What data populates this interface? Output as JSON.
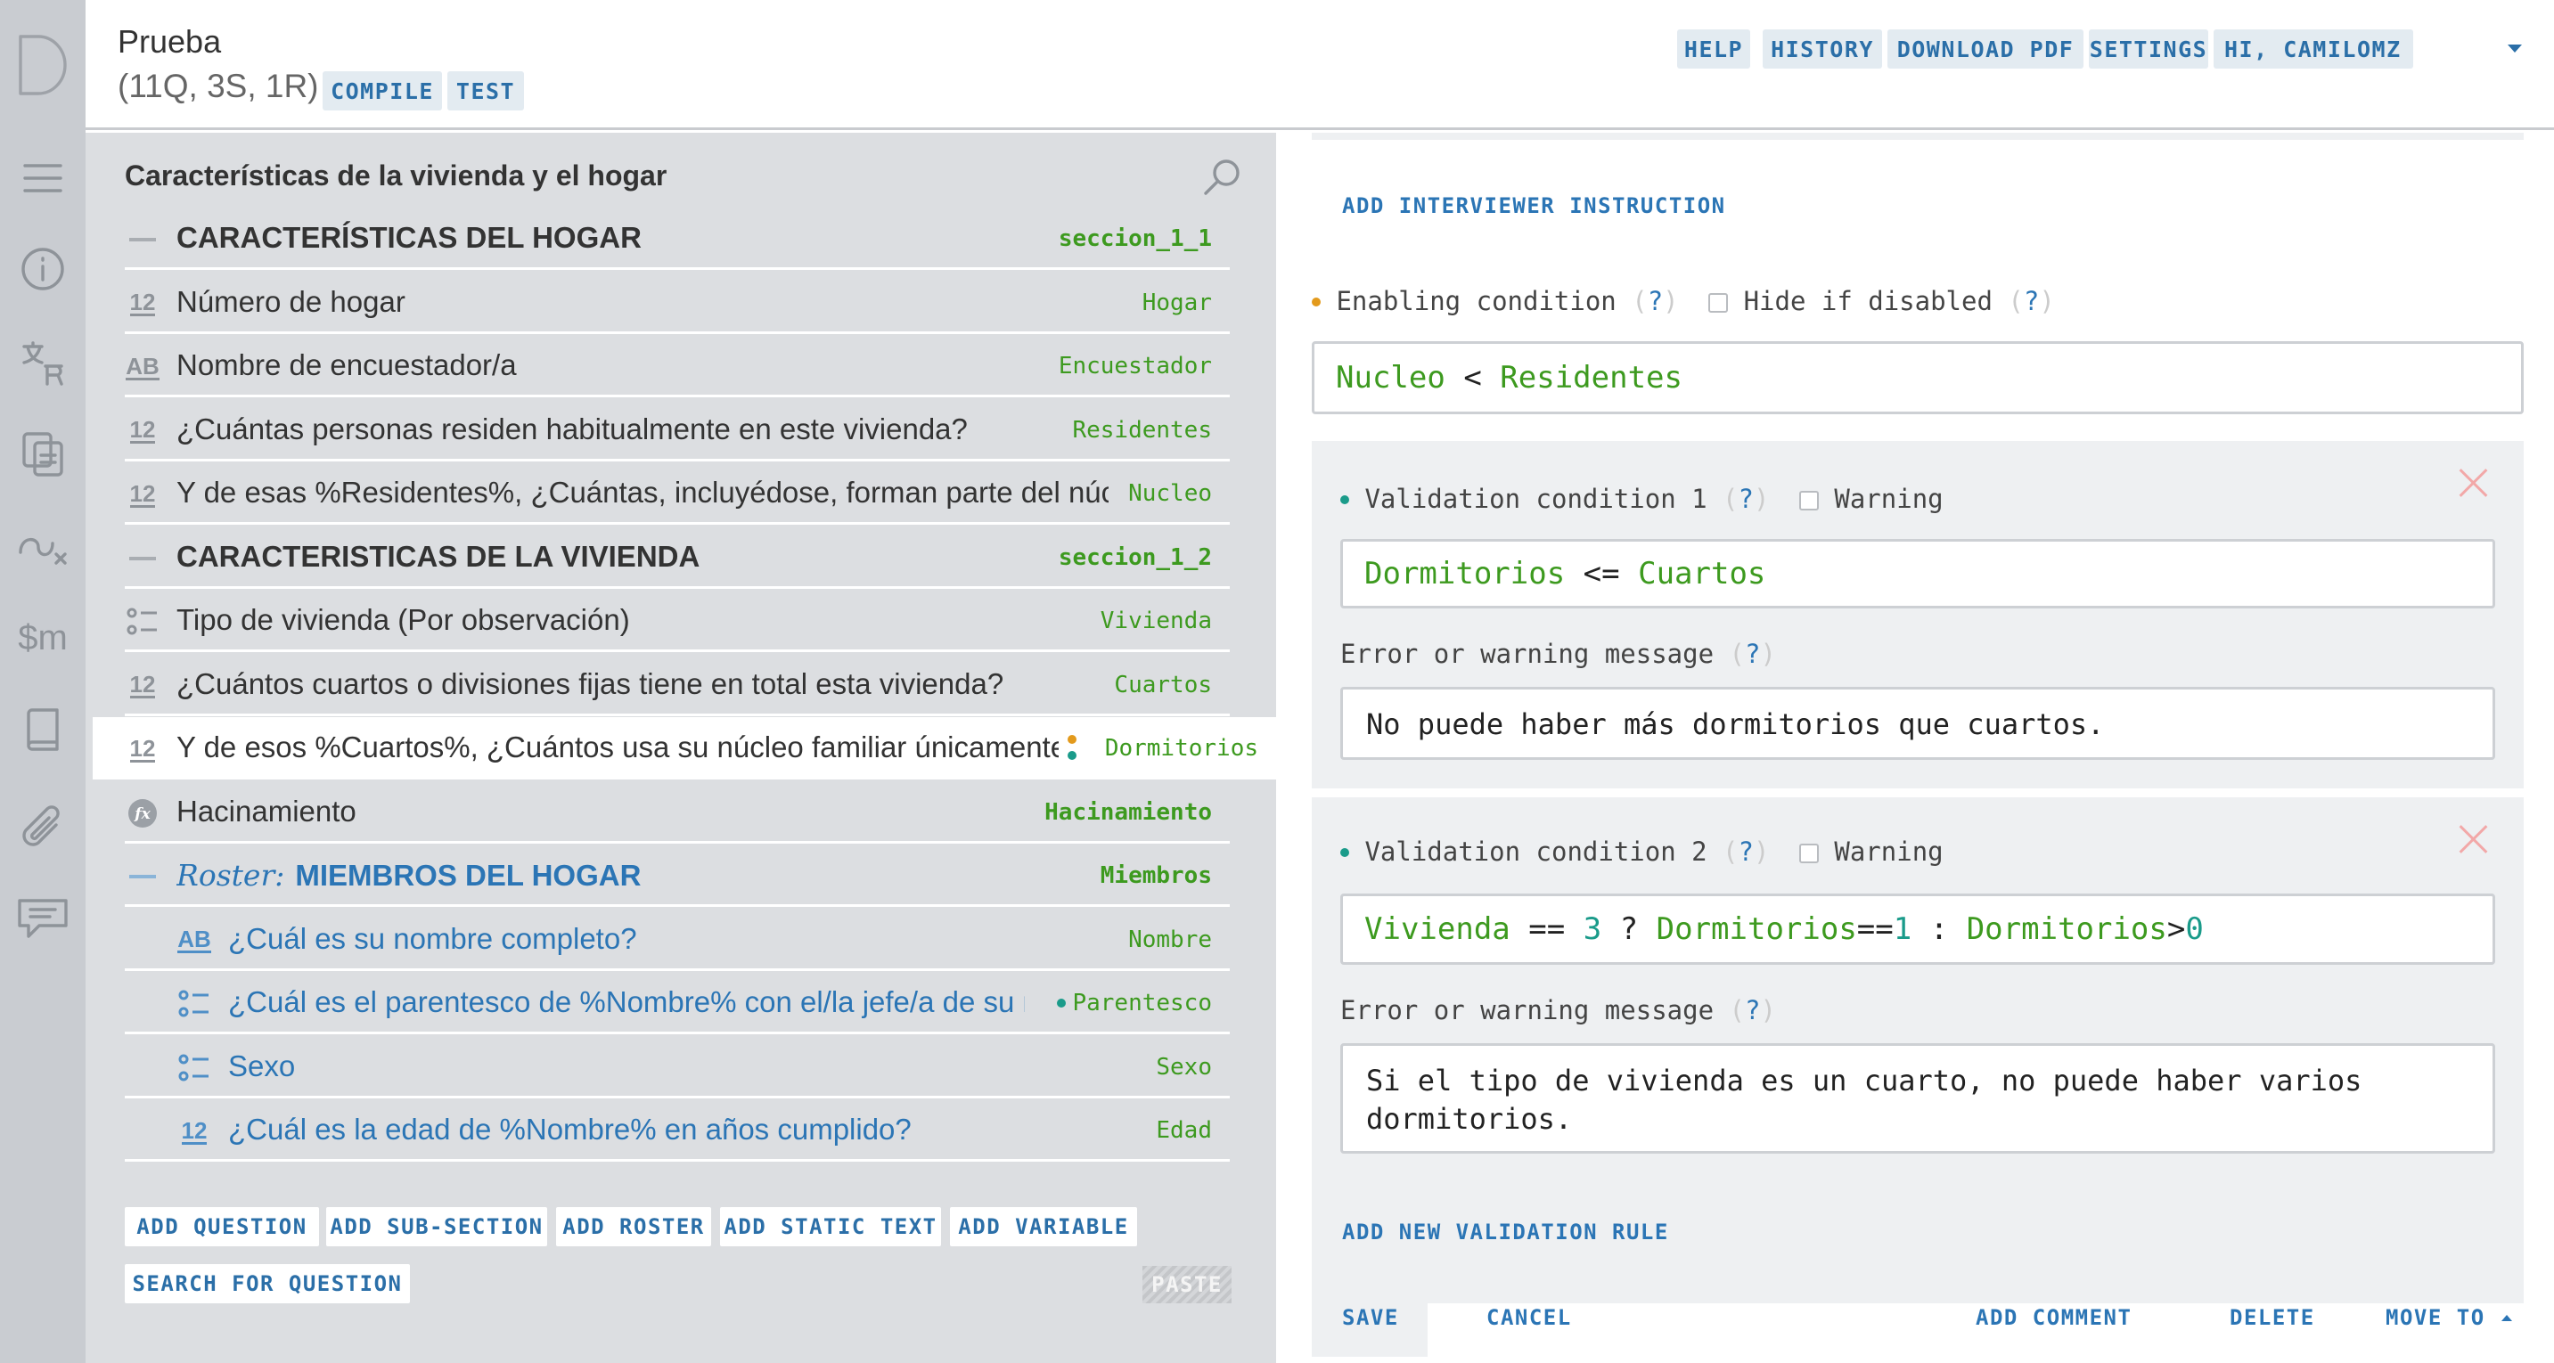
{
  "header": {
    "title": "Prueba",
    "counts": "(11Q, 3S, 1R)",
    "compile": "COMPILE",
    "test": "TEST",
    "help": "HELP",
    "history": "HISTORY",
    "download_pdf": "DOWNLOAD PDF",
    "settings": "SETTINGS",
    "user": "HI, CAMILOMZ"
  },
  "rail": {
    "logo": "D",
    "icons": [
      "menu-icon",
      "info-icon",
      "translate-icon",
      "copy-icon",
      "route-icon",
      "macros-icon",
      "book-icon",
      "attachment-icon",
      "comments-icon"
    ],
    "macro_label": "$m"
  },
  "outline": {
    "section_title": "Características de la vivienda y el hogar",
    "rows": [
      {
        "type": "section",
        "icon": "—",
        "text": "CARACTERÍSTICAS DEL HOGAR",
        "var": "seccion_1_1"
      },
      {
        "type": "numeric",
        "icon": "12",
        "text": "Número de hogar",
        "var": "Hogar"
      },
      {
        "type": "text",
        "icon": "AB",
        "text": "Nombre de encuestador/a",
        "var": "Encuestador"
      },
      {
        "type": "numeric",
        "icon": "12",
        "text": "¿Cuántas personas residen habitualmente en este vivienda?",
        "var": "Residentes"
      },
      {
        "type": "numeric",
        "icon": "12",
        "text": "Y de esas %Residentes%, ¿Cuántas, incluyédose, forman parte del núcleo",
        "var": "Nucleo"
      },
      {
        "type": "section",
        "icon": "—",
        "text": "CARACTERISTICAS DE LA VIVIENDA",
        "var": "seccion_1_2"
      },
      {
        "type": "single",
        "icon": "list",
        "text": "Tipo de vivienda (Por observación)",
        "var": "Vivienda"
      },
      {
        "type": "numeric",
        "icon": "12",
        "text": "¿Cuántos cuartos o divisiones fijas tiene en total esta vivienda?",
        "var": "Cuartos"
      },
      {
        "type": "numeric",
        "icon": "12",
        "text": "Y de esos %Cuartos%, ¿Cuántos usa su núcleo familiar únicamente",
        "var": "Dormitorios"
      },
      {
        "type": "variable",
        "icon": "fx",
        "text": "Hacinamiento",
        "var": "Hacinamiento"
      },
      {
        "type": "roster",
        "icon": "—",
        "roster_label": "Roster:",
        "text": "MIEMBROS DEL HOGAR",
        "var": "Miembros"
      },
      {
        "type": "text",
        "icon": "AB",
        "text": "¿Cuál es su nombre completo?",
        "var": "Nombre"
      },
      {
        "type": "single",
        "icon": "list",
        "text": "¿Cuál es el parentesco de %Nombre% con el/la jefe/a de su núcl",
        "var": "Parentesco"
      },
      {
        "type": "single",
        "icon": "list",
        "text": "Sexo",
        "var": "Sexo"
      },
      {
        "type": "numeric",
        "icon": "12",
        "text": "¿Cuál es la edad de %Nombre% en años cumplido?",
        "var": "Edad"
      }
    ],
    "buttons": {
      "add_question": "ADD QUESTION",
      "add_subsection": "ADD SUB-SECTION",
      "add_roster": "ADD ROSTER",
      "add_static_text": "ADD STATIC TEXT",
      "add_variable": "ADD VARIABLE",
      "search_for_question": "SEARCH FOR QUESTION",
      "paste": "PASTE"
    }
  },
  "editor": {
    "add_interviewer_instruction": "ADD INTERVIEWER INSTRUCTION",
    "enabling_condition_label": "Enabling condition",
    "hide_if_disabled_label": "Hide if disabled",
    "help_mark": "?",
    "enabling_expr": {
      "a": "Nucleo",
      "op": "<",
      "b": "Residentes"
    },
    "validations": [
      {
        "label": "Validation condition 1",
        "warning_label": "Warning",
        "expr": {
          "a": "Dormitorios",
          "op": "<=",
          "b": "Cuartos"
        },
        "message_label": "Error or warning message",
        "message": "No puede haber más dormitorios que cuartos."
      },
      {
        "label": "Validation condition 2",
        "warning_label": "Warning",
        "expr": {
          "t1": "Vivienda",
          "t2": "==",
          "t3": "3",
          "t4": "?",
          "t5": "Dormitorios",
          "t6": "==",
          "t7": "1",
          "t8": ":",
          "t9": "Dormitorios",
          "t10": ">",
          "t11": "0"
        },
        "message_label": "Error or warning message",
        "message": "Si el tipo de vivienda es un cuarto, no puede haber varios dormitorios."
      }
    ],
    "add_new_validation_rule": "ADD NEW VALIDATION RULE",
    "save": "SAVE",
    "cancel": "CANCEL",
    "add_comment": "ADD COMMENT",
    "delete": "DELETE",
    "move_to": "MOVE TO"
  },
  "colors": {
    "accent": "#2b75b5",
    "variable_green": "#3d9a1f",
    "number_teal": "#1a9b8a",
    "warning_orange": "#e39a1c",
    "panel_gray": "#dcdee1",
    "rail_gray": "#c9ccd1",
    "delete_pink": "#f2a8a8"
  }
}
